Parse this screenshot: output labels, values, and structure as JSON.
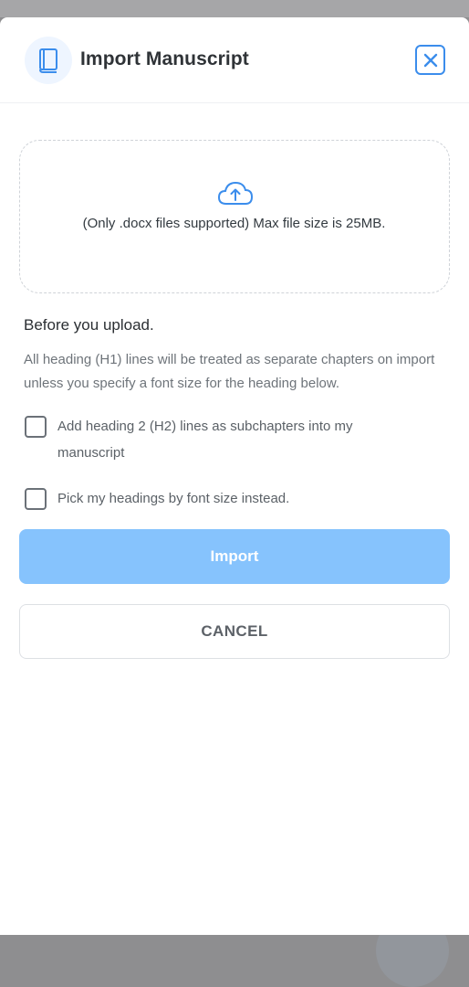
{
  "modal": {
    "title": "Import Manuscript",
    "header_icon": "book-icon",
    "close_icon": "close-icon"
  },
  "dropzone": {
    "icon": "cloud-upload-icon",
    "text": "(Only .docx files supported) Max file size is 25MB."
  },
  "instructions": {
    "title": "Before you upload.",
    "description": "All heading (H1) lines will be treated as separate chapters on import unless you specify a font size for the heading below."
  },
  "options": [
    {
      "label": "Add heading 2 (H2) lines as subchapters into my manuscript",
      "checked": false
    },
    {
      "label": "Pick my headings by font size instead.",
      "checked": false
    }
  ],
  "actions": {
    "import_label": "Import",
    "cancel_label": "CANCEL"
  },
  "colors": {
    "accent": "#3b8dec",
    "import_button": "#86c3fd",
    "title_text": "#2f3337",
    "body_text": "#6e747a"
  }
}
